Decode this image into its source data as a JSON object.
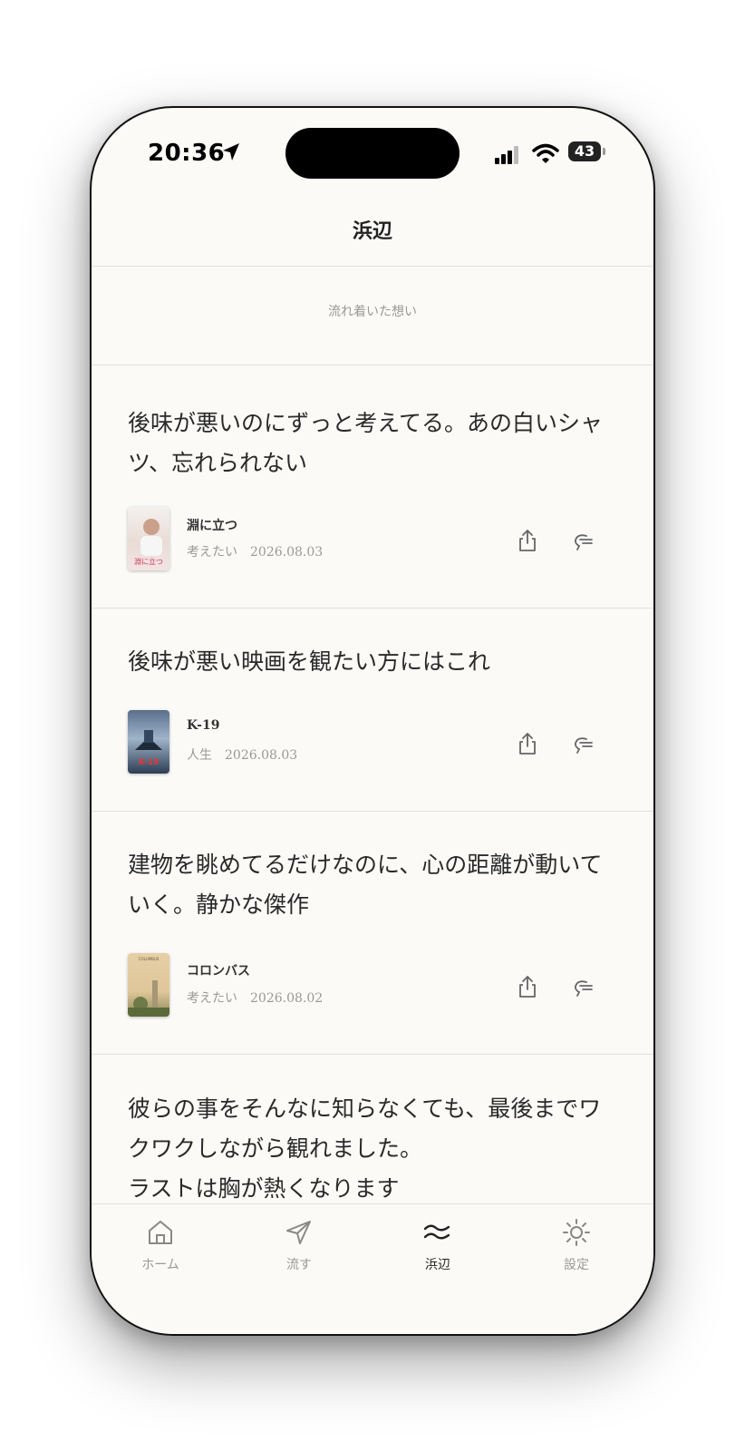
{
  "status_bar": {
    "time": "20:36",
    "battery": "43"
  },
  "header": {
    "title": "浜辺",
    "subtitle": "流れ着いた想い"
  },
  "posts": [
    {
      "text": "後味が悪いのにずっと考えてる。あの白いシャ\nツ、忘れられない",
      "movie_title": "淵に立つ",
      "meta": "考えたい　2026.08.03",
      "poster_text": "淵に立つ"
    },
    {
      "text": "後味が悪い映画を観たい方にはこれ",
      "movie_title": "K-19",
      "meta": "人生　2026.08.03",
      "poster_text": "K-19"
    },
    {
      "text": "建物を眺めてるだけなのに、心の距離が動いて\nいく。静かな傑作",
      "movie_title": "コロンバス",
      "meta": "考えたい　2026.08.02",
      "poster_text": "COLUMBUS"
    },
    {
      "text": "彼らの事をそんなに知らなくても、最後までワ\nクワクしながら観れました。\nラストは胸が熱くなります"
    }
  ],
  "tabs": [
    {
      "label": "ホーム",
      "icon": "home-icon"
    },
    {
      "label": "流す",
      "icon": "send-icon"
    },
    {
      "label": "浜辺",
      "icon": "waves-icon",
      "active": true
    },
    {
      "label": "設定",
      "icon": "sun-icon"
    }
  ],
  "colors": {
    "background": "#fbfaf7",
    "text": "#2a2a2a",
    "muted": "#999999",
    "divider": "#e2e0db"
  }
}
